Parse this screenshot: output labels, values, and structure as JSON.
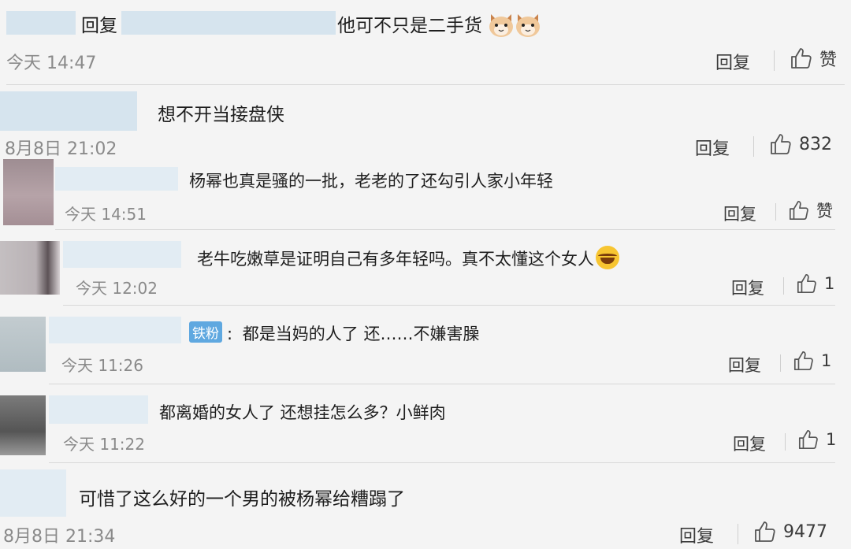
{
  "comments": [
    {
      "text_prefix": "回复",
      "text_suffix": "他可不只是二手货",
      "emoji": "cat-face-emoji x2",
      "time": "今天 14:47",
      "reply": "回复",
      "like": "赞"
    },
    {
      "text": "想不开当接盘侠",
      "time": "8月8日 21:02",
      "reply": "回复",
      "like": "832"
    },
    {
      "text": "杨幂也真是骚的一批，老老的了还勾引人家小年轻",
      "time": "今天 14:51",
      "reply": "回复",
      "like": "赞"
    },
    {
      "text": "老牛吃嫩草是证明自己有多年轻吗。真不太懂这个女人",
      "emoji": "laugh-cry-emoji",
      "time": "今天 12:02",
      "reply": "回复",
      "like": "1"
    },
    {
      "badge": "铁粉",
      "colon": ":",
      "text": "都是当妈的人了 还……不嫌害臊",
      "time": "今天 11:26",
      "reply": "回复",
      "like": "1"
    },
    {
      "text": "都离婚的女人了 还想挂怎么多？小鲜肉",
      "time": "今天 11:22",
      "reply": "回复",
      "like": "1"
    },
    {
      "text": "可惜了这么好的一个男的被杨幂给糟蹋了",
      "time": "8月8日 21:34",
      "reply": "回复",
      "like": "9477"
    }
  ],
  "colors": {
    "background": "#f4f4f4",
    "mask": "#d6e4ee",
    "badge": "#5fa8e0",
    "time": "#8a8a8a"
  }
}
